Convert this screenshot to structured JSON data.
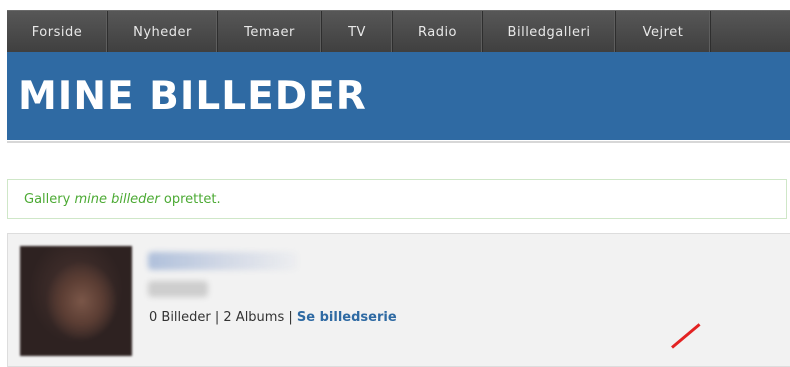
{
  "nav": {
    "items": [
      "Forside",
      "Nyheder",
      "Temaer",
      "TV",
      "Radio",
      "Billedgalleri",
      "Vejret"
    ]
  },
  "banner": {
    "title": "MINE BILLEDER"
  },
  "message": {
    "prefix": "Gallery",
    "gallery_name": "mine billeder",
    "suffix": "oprettet."
  },
  "profile": {
    "stats_text": "0 Billeder | 2 Albums |",
    "series_link": "Se billedserie"
  },
  "colors": {
    "nav_bg": "#484848",
    "banner_bg": "#2f6aa3",
    "message_text": "#4caa34",
    "link": "#2f6aa3",
    "annotation": "#e32222"
  }
}
